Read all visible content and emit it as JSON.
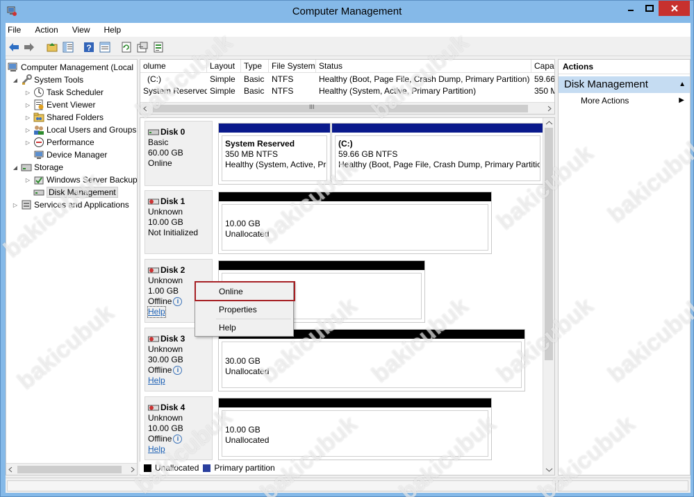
{
  "window": {
    "title": "Computer Management",
    "accent": "#85b9e8",
    "close_color": "#c7312e"
  },
  "menubar": {
    "items": [
      "File",
      "Action",
      "View",
      "Help"
    ]
  },
  "toolbar": {
    "buttons": [
      "back-arrow-icon",
      "forward-arrow-icon",
      "up-folder-icon",
      "show-hide-tree-icon",
      "help-icon",
      "console-tree-icon",
      "refresh-icon",
      "properties-icon",
      "export-icon"
    ]
  },
  "tree": {
    "items": [
      {
        "label": "Computer Management (Local",
        "icon": "computer-management-icon",
        "expander": ""
      },
      {
        "label": "System Tools",
        "icon": "system-tools-icon",
        "expander": "◢"
      },
      {
        "label": "Task Scheduler",
        "icon": "clock-icon",
        "expander": "▷"
      },
      {
        "label": "Event Viewer",
        "icon": "event-viewer-icon",
        "expander": "▷"
      },
      {
        "label": "Shared Folders",
        "icon": "shared-folder-icon",
        "expander": "▷"
      },
      {
        "label": "Local Users and Groups",
        "icon": "users-icon",
        "expander": "▷"
      },
      {
        "label": "Performance",
        "icon": "performance-icon",
        "expander": "▷"
      },
      {
        "label": "Device Manager",
        "icon": "device-manager-icon",
        "expander": ""
      },
      {
        "label": "Storage",
        "icon": "storage-icon",
        "expander": "◢"
      },
      {
        "label": "Windows Server Backup",
        "icon": "backup-icon",
        "expander": "▷"
      },
      {
        "label": "Disk Management",
        "icon": "disk-management-icon",
        "expander": ""
      },
      {
        "label": "Services and Applications",
        "icon": "services-icon",
        "expander": "▷"
      }
    ]
  },
  "volumes": {
    "columns": [
      "olume",
      "Layout",
      "Type",
      "File System",
      "Status",
      "Capa"
    ],
    "rows": [
      [
        "(C:)",
        "Simple",
        "Basic",
        "NTFS",
        "Healthy (Boot, Page File, Crash Dump, Primary Partition)",
        "59.66"
      ],
      [
        "System Reserved",
        "Simple",
        "Basic",
        "NTFS",
        "Healthy (System, Active, Primary Partition)",
        "350 M"
      ]
    ],
    "scroll_grip": "III"
  },
  "disks": [
    {
      "name": "Disk 0",
      "lines": [
        "Basic",
        "60.00 GB",
        "Online"
      ],
      "help": "",
      "partitions": [
        {
          "title": "System Reserved",
          "line1": "350 MB NTFS",
          "line2": "Healthy (System, Active, Pri",
          "bar": "#0a1a8c"
        },
        {
          "title": "(C:)",
          "line1": "59.66 GB NTFS",
          "line2": "Healthy (Boot, Page File, Crash Dump, Primary Partition",
          "bar": "#0a1a8c"
        }
      ]
    },
    {
      "name": "Disk 1",
      "lines": [
        "Unknown",
        "10.00 GB",
        "Not Initialized"
      ],
      "help": "",
      "partitions": [
        {
          "title": "",
          "line1": "10.00 GB",
          "line2": "Unallocated",
          "bar": "#000000"
        }
      ]
    },
    {
      "name": "Disk 2",
      "lines": [
        "Unknown",
        "1.00 GB",
        "Offline"
      ],
      "help": "Help",
      "partitions": [
        {
          "title": "",
          "line1": "",
          "line2": "",
          "bar": "#000000"
        }
      ]
    },
    {
      "name": "Disk 3",
      "lines": [
        "Unknown",
        "30.00 GB",
        "Offline"
      ],
      "help": "Help",
      "partitions": [
        {
          "title": "",
          "line1": "30.00 GB",
          "line2": "Unallocated",
          "bar": "#000000"
        }
      ]
    },
    {
      "name": "Disk 4",
      "lines": [
        "Unknown",
        "10.00 GB",
        "Offline"
      ],
      "help": "Help",
      "partitions": [
        {
          "title": "",
          "line1": "10.00 GB",
          "line2": "Unallocated",
          "bar": "#000000"
        }
      ]
    }
  ],
  "legend": {
    "unallocated": "Unallocated",
    "primary": "Primary partition",
    "unallocated_color": "#000000",
    "primary_color": "#2a3f9e"
  },
  "actions": {
    "header": "Actions",
    "section": "Disk Management",
    "more": "More Actions"
  },
  "context_menu": {
    "items": [
      "Online",
      "Properties",
      "Help"
    ]
  },
  "watermark": "bakicubuk"
}
